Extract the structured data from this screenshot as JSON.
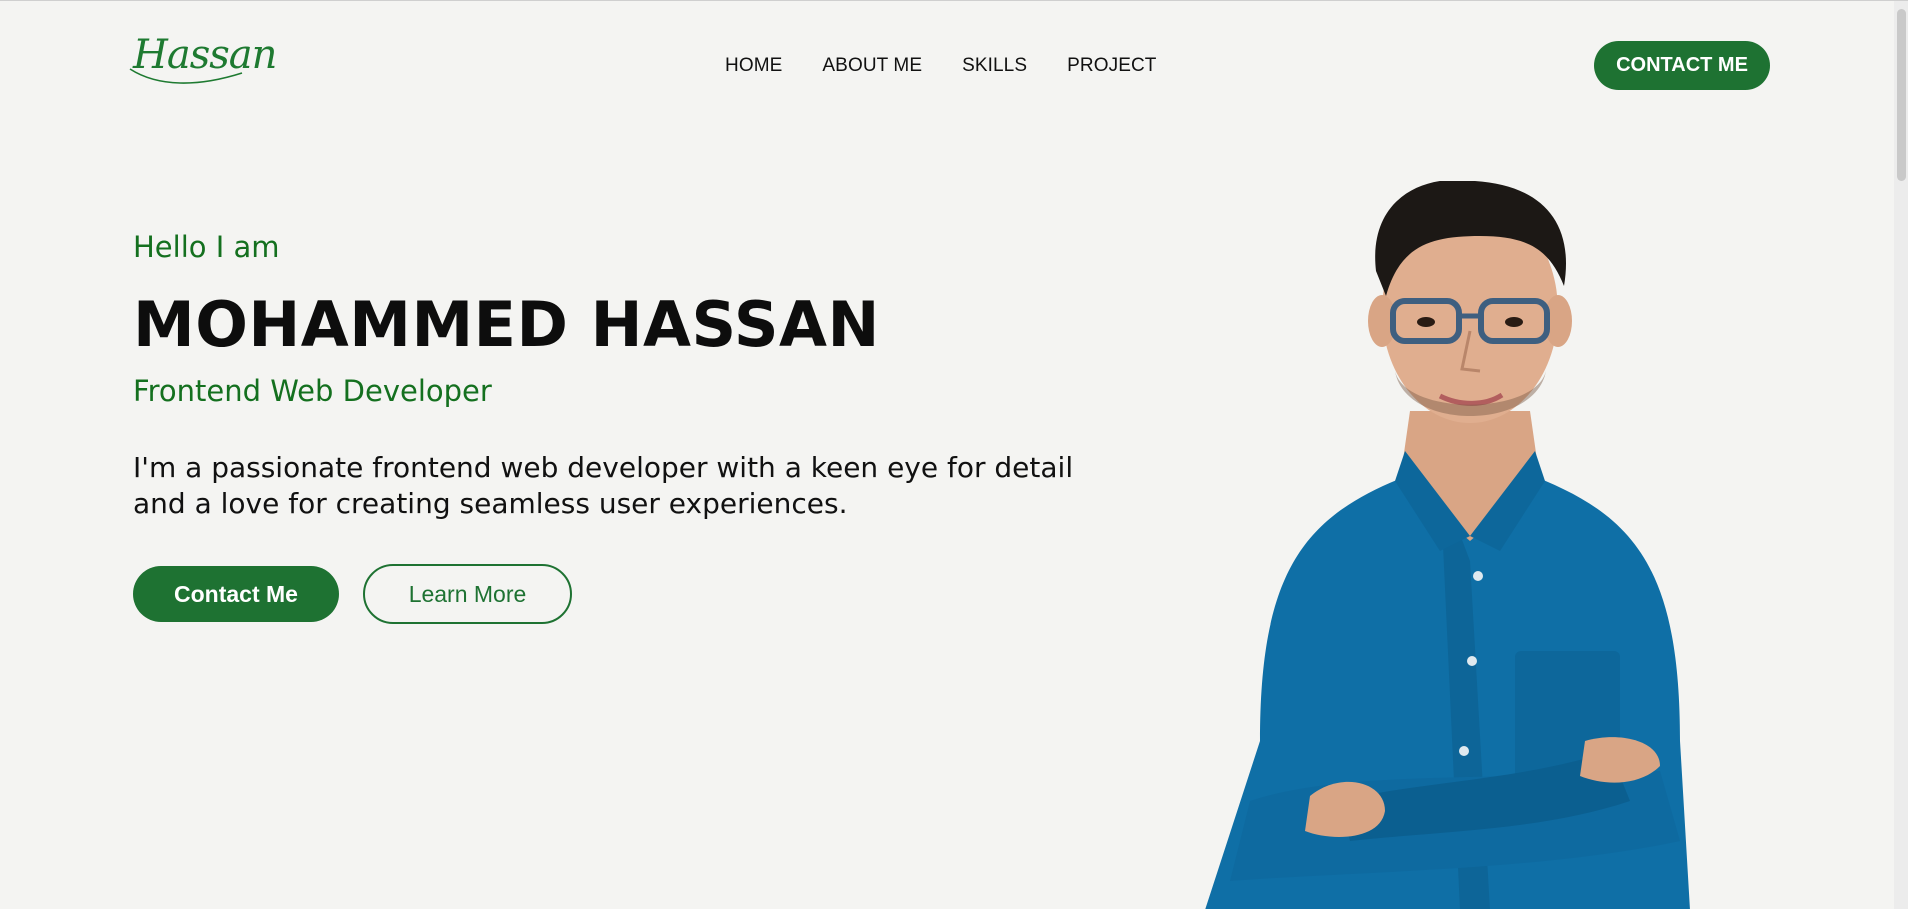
{
  "header": {
    "logo_text": "Hassan",
    "nav": [
      {
        "label": "HOME"
      },
      {
        "label": "ABOUT ME"
      },
      {
        "label": "SKILLS"
      },
      {
        "label": "PROJECT"
      }
    ],
    "cta_label": "CONTACT ME"
  },
  "hero": {
    "greeting": "Hello I am",
    "name": "MOHAMMED HASSAN",
    "role": "Frontend Web Developer",
    "intro": "I'm a passionate frontend web developer with a keen eye for detail and a love for creating seamless user experiences.",
    "primary_button": "Contact Me",
    "secondary_button": "Learn More"
  },
  "colors": {
    "brand_green": "#1e7232",
    "background": "#f4f4f2",
    "shirt_blue": "#0f6fa6"
  },
  "icons": [
    "logo-swash-icon",
    "portrait-photo"
  ]
}
